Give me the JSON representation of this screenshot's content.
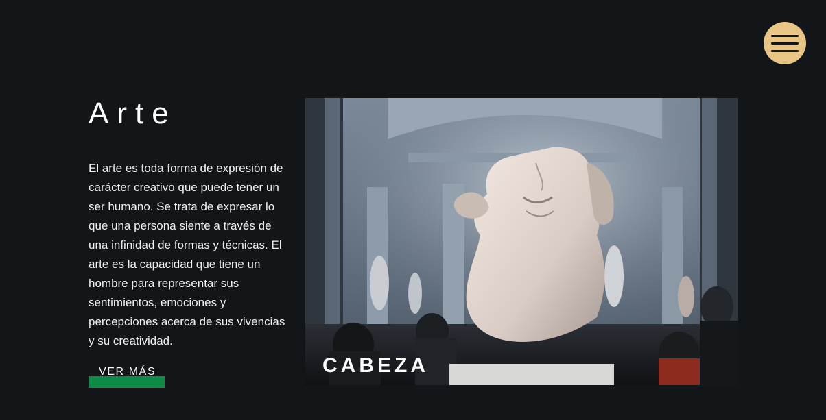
{
  "hero": {
    "title": "Arte",
    "description": "El arte es toda forma de expresión de carácter creativo que puede tener un ser humano. Se trata de expresar lo que una persona siente a través de una infinidad de formas y técnicas. El arte es la capacidad que tiene un hombre para representar sus sentimientos, emociones y percepciones acerca de sus vivencias y su creatividad.",
    "cta_label": "VER MÁS",
    "image_caption": "CABEZA"
  },
  "menu": {
    "icon": "hamburger-icon"
  },
  "colors": {
    "background": "#121619",
    "accent": "#e8c584",
    "cta": "#0d8a45"
  }
}
